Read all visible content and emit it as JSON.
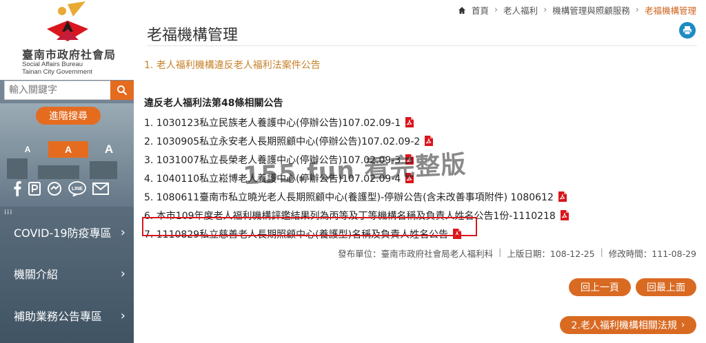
{
  "colors": {
    "accent": "#e56b1f",
    "link": "#c7812a",
    "highlight": "#d9161d",
    "print": "#1e8bc3"
  },
  "sidebar": {
    "org_name_zh": "臺南市政府社會局",
    "org_name_en_1": "Social Affairs Bureau",
    "org_name_en_2": "Tainan City Government",
    "search_placeholder": "輸入關鍵字",
    "advanced_search_label": "進階搜尋",
    "font_sizes": [
      "A",
      "A",
      "A"
    ],
    "social_icons": [
      "facebook-icon",
      "plurk-icon",
      "share-icon",
      "line-icon",
      "mail-icon"
    ],
    "menu": [
      {
        "label": "COVID-19防疫專區"
      },
      {
        "label": "機關介紹"
      },
      {
        "label": "補助業務公告專區"
      }
    ]
  },
  "breadcrumb": {
    "home": "首頁",
    "items": [
      "老人福利",
      "機構管理與照顧服務",
      "老福機構管理"
    ]
  },
  "page": {
    "title": "老福機構管理",
    "section_link": "1. 老人福利機構違反老人福利法案件公告",
    "notice_heading": "違反老人福利法第48條相關公告",
    "documents": [
      "1. 1030123私立民族老人養護中心(停辦公告)107.02.09-1",
      "2. 1030905私立永安老人長期照顧中心(停辦公告)107.02.09-2",
      "3. 1031007私立長榮老人養護中心(停辦公告)107.02.09-3",
      "4. 1040110私立崧博老人養護中心(停辦公告)107.02.09-4",
      "5. 1080611臺南市私立曉光老人長期照顧中心(養護型)-停辦公告(含未改善事項附件) 1080612",
      "6. 本市109年度老人福利機構評鑑結果列為丙等及丁等機構名稱及負責人姓名公告1份-1110218",
      "7. 1110829私立慈善老人長期照顧中心(養護型)名稱及負責人姓名公告"
    ],
    "meta": {
      "publisher": "發布單位：臺南市政府社會局老人福利科",
      "online_date": "上版日期：108-12-25",
      "modified": "修改時間：111-08-29"
    },
    "buttons": {
      "prev": "回上一頁",
      "top": "回最上面",
      "next": "2.老人福利機構相關法規"
    },
    "watermark": "155.fun 看完整版"
  }
}
